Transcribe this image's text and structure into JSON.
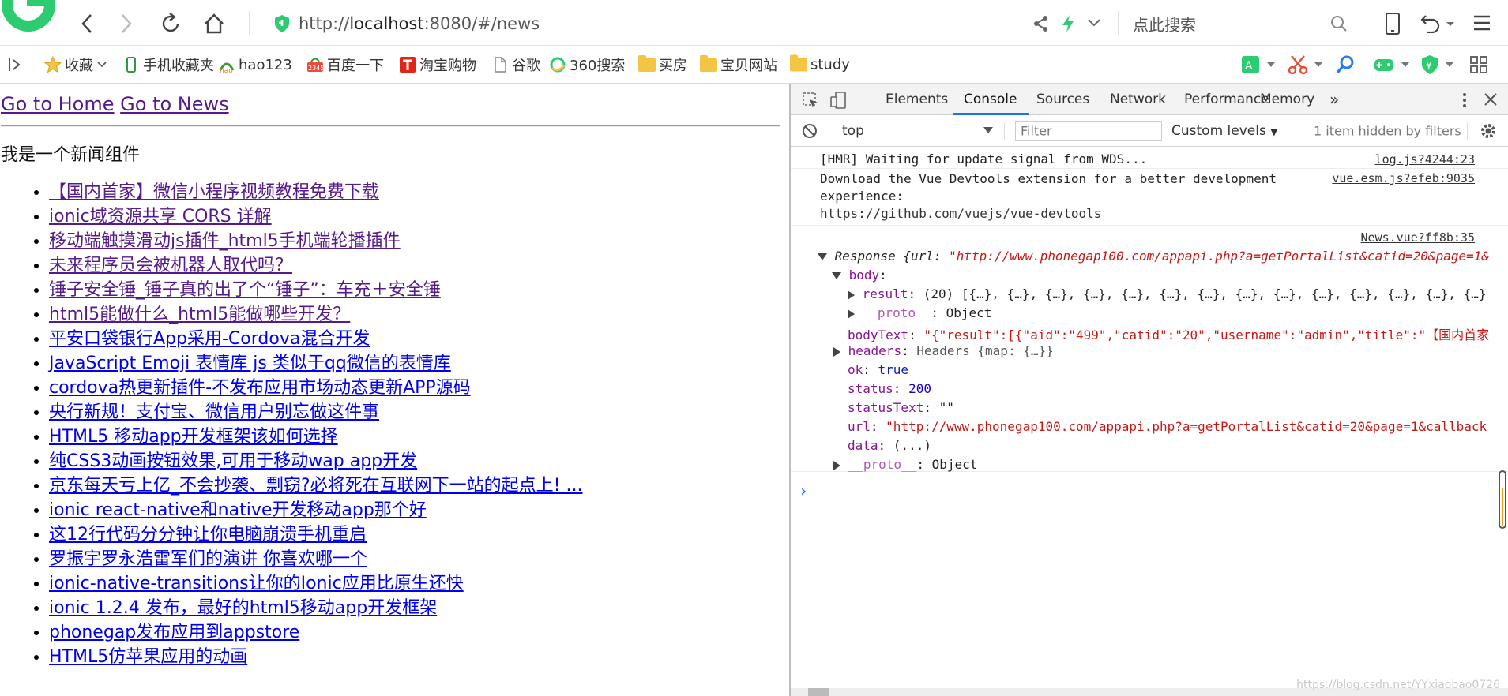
{
  "browser": {
    "url_prefix": "http://",
    "url_host": "localhost",
    "url_rest": ":8080/#/news",
    "search_placeholder": "点此搜索"
  },
  "bookmarks": [
    {
      "label": "收藏"
    },
    {
      "label": "手机收藏夹"
    },
    {
      "label": "hao123"
    },
    {
      "label": "百度一下"
    },
    {
      "label": "淘宝购物"
    },
    {
      "label": "谷歌"
    },
    {
      "label": "360搜索"
    },
    {
      "label": "买房"
    },
    {
      "label": "宝贝网站"
    },
    {
      "label": "study"
    }
  ],
  "page": {
    "nav_home": "Go to Home",
    "nav_news": "Go to News",
    "component_title": "我是一个新闻组件",
    "news": [
      "【国内首家】微信小程序视频教程免费下载",
      "ionic域资源共享 CORS 详解",
      "移动端触摸滑动js插件_html5手机端轮播插件",
      "未来程序员会被机器人取代吗？",
      "锤子安全锤_锤子真的出了个“锤子”：车充＋安全锤",
      "html5能做什么_html5能做哪些开发？",
      "平安口袋银行App采用-Cordova混合开发",
      "JavaScript Emoji 表情库 js 类似于qq微信的表情库",
      "cordova热更新插件-不发布应用市场动态更新APP源码",
      "央行新规！支付宝、微信用户别忘做这件事",
      "HTML5 移动app开发框架该如何选择",
      "纯CSS3动画按钮效果,可用于移动wap app开发",
      "京东每天亏上亿_不会抄袭、剽窃?必将死在互联网下一站的起点上! ...",
      "ionic react-native和native开发移动app那个好",
      "这12行代码分分钟让你电脑崩溃手机重启",
      "罗振宇罗永浩雷军们的演讲 你喜欢哪一个",
      "ionic-native-transitions让你的Ionic应用比原生还快",
      "ionic 1.2.4 发布，最好的html5移动app开发框架",
      "phonegap发布应用到appstore",
      "HTML5仿苹果应用的动画"
    ]
  },
  "devtools": {
    "tabs": [
      "Elements",
      "Console",
      "Sources",
      "Network",
      "Performance",
      "Memory"
    ],
    "more_tabs": "»",
    "context": "top",
    "filter_placeholder": "Filter",
    "levels": "Custom levels",
    "hidden_note": "1 item hidden by filters",
    "messages": {
      "hmr": "[HMR] Waiting for update signal from WDS...",
      "hmr_src": "log.js?4244:23",
      "vue_line1": "Download the Vue Devtools extension for a better development",
      "vue_line2": "experience:",
      "vue_link": "https://github.com/vuejs/vue-devtools",
      "vue_src": "vue.esm.js?efeb:9035",
      "news_src": "News.vue?ff8b:35"
    },
    "response": {
      "head_label": "Response",
      "head_open": "{url: ",
      "head_url": "\"http://www.phonegap100.com/appapi.php?a=getPortalList&catid=20&page=1&",
      "body_key": "body",
      "result_key": "result",
      "result_val": "(20) [{…}, {…}, {…}, {…}, {…}, {…}, {…}, {…}, {…}, {…}, {…}, {…}, {…}, {…}",
      "proto_key": "__proto__",
      "proto_val": "Object",
      "bodytext_key": "bodyText",
      "bodytext_val": "\"{\"result\":[{\"aid\":\"499\",\"catid\":\"20\",\"username\":\"admin\",\"title\":\"【国内首家",
      "headers_key": "headers",
      "headers_val": "Headers {map: {…}}",
      "ok_key": "ok",
      "ok_val": "true",
      "status_key": "status",
      "status_val": "200",
      "statustext_key": "statusText",
      "statustext_val": "\"\"",
      "url_key": "url",
      "url_val": "\"http://www.phonegap100.com/appapi.php?a=getPortalList&catid=20&page=1&callback",
      "data_key": "data",
      "data_val": "(...)",
      "proto2_key": "__proto__",
      "proto2_val": "Object"
    },
    "prompt": "›",
    "watermark": "https://blog.csdn.net/YYxiaobao0726"
  }
}
